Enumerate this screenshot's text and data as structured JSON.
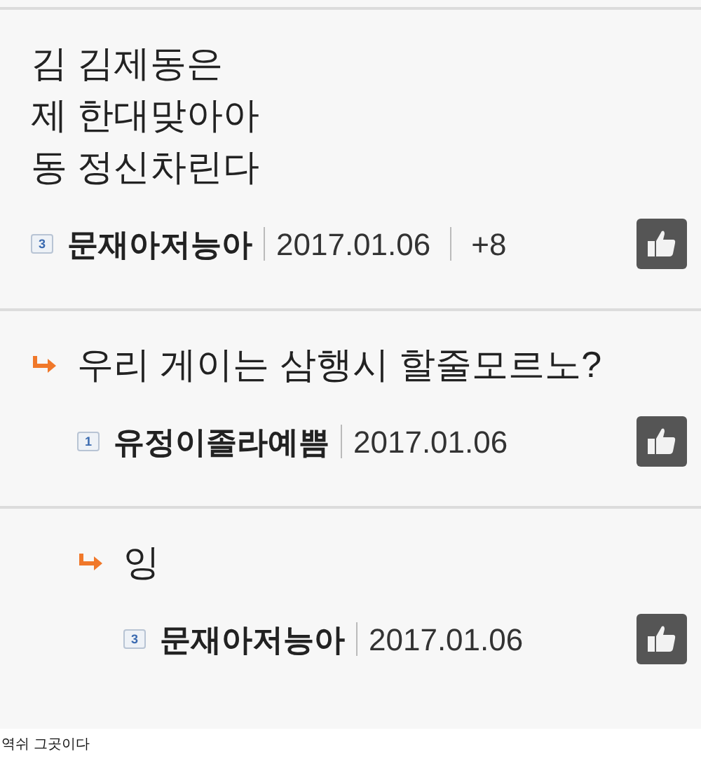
{
  "comments": [
    {
      "lines": [
        "김 김제동은",
        "제 한대맞아아",
        "동 정신차린다"
      ],
      "level_badge": "3",
      "author": "문재아저능아",
      "date": "2017.01.06",
      "score": "+8",
      "children": [
        {
          "lines": [
            "우리 게이는 삼행시 할줄모르노?"
          ],
          "level_badge": "1",
          "author": "유정이졸라예쁨",
          "date": "2017.01.06",
          "children": [
            {
              "lines": [
                "잉"
              ],
              "level_badge": "3",
              "author": "문재아저능아",
              "date": "2017.01.06"
            }
          ]
        }
      ]
    }
  ],
  "caption": "역쉬 그곳이다"
}
